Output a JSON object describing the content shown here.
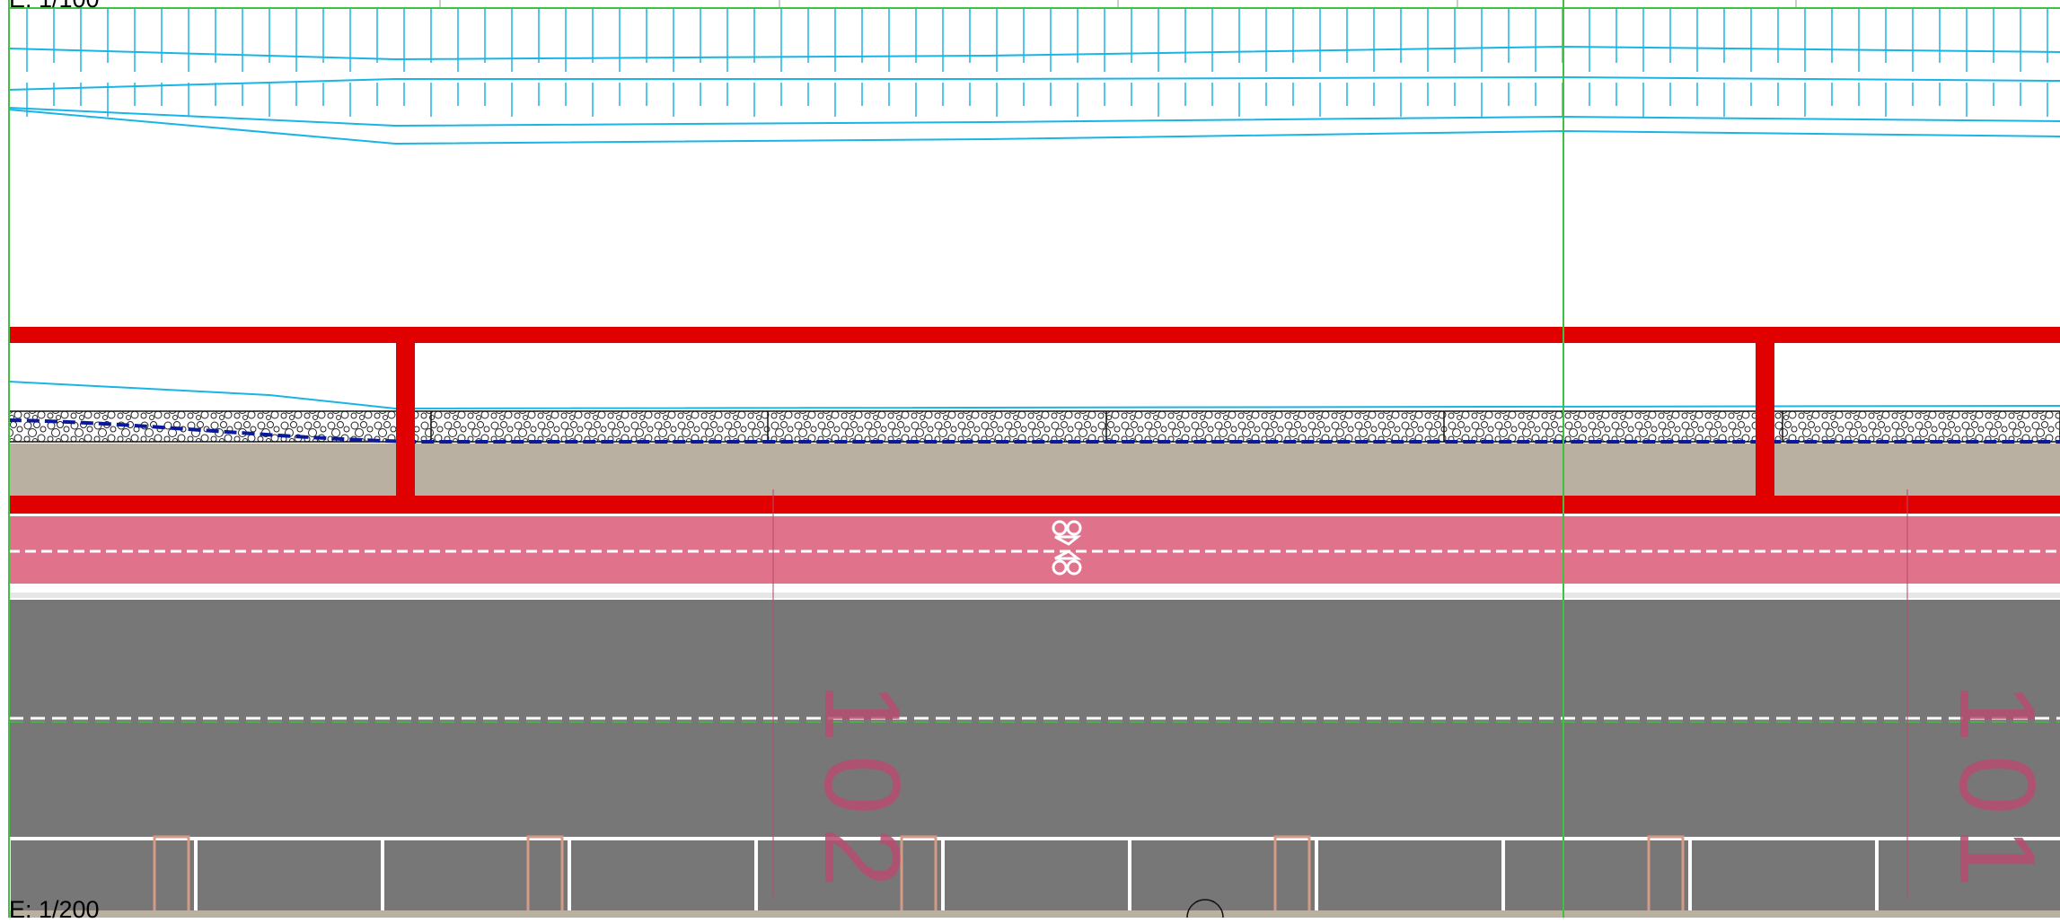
{
  "drawing": {
    "scale_top": "E: 1/100",
    "scale_bottom": "E: 1/200",
    "station_labels": [
      "102",
      "101"
    ]
  },
  "colors": {
    "background": "#ffffff",
    "profile_cyan": "#19b5e6",
    "guide_green": "#3fc23f",
    "frame_red": "#e00000",
    "gravel_fill": "#ffffff",
    "subbase_beige": "#b9b0a2",
    "bike_lane_pink": "#e0728c",
    "road_gray": "#777777",
    "marking_white": "#ffffff",
    "station_pink": "#b84c70",
    "drain_blue": "#0a1a9a"
  },
  "icons": {
    "bike_symbol": "bicycle-icon",
    "manhole": "manhole-icon"
  }
}
